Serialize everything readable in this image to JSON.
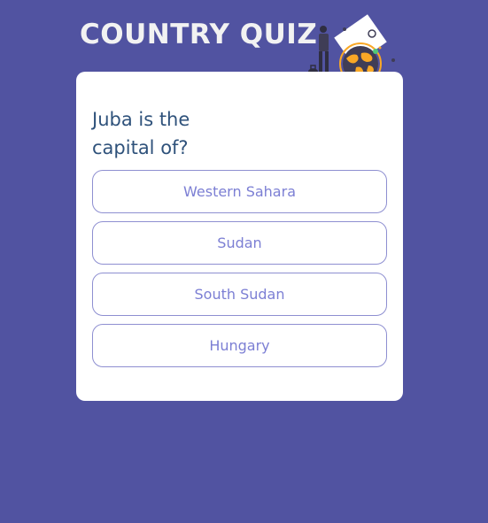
{
  "app": {
    "title": "COUNTRY QUIZ"
  },
  "question": {
    "text": "Juba is the capital of?"
  },
  "options": [
    {
      "label": "Western Sahara"
    },
    {
      "label": "Sudan"
    },
    {
      "label": "South Sudan"
    },
    {
      "label": "Hungary"
    }
  ],
  "colors": {
    "background": "#5153A1",
    "card": "#FFFFFF",
    "title": "#F2F2F2",
    "question": "#2F527B",
    "option_text": "#7C7FD4",
    "option_border": "#8E8FD1",
    "accent": "#F9A826"
  },
  "icons": {
    "header_illustration": "traveler-with-globe-illustration"
  }
}
